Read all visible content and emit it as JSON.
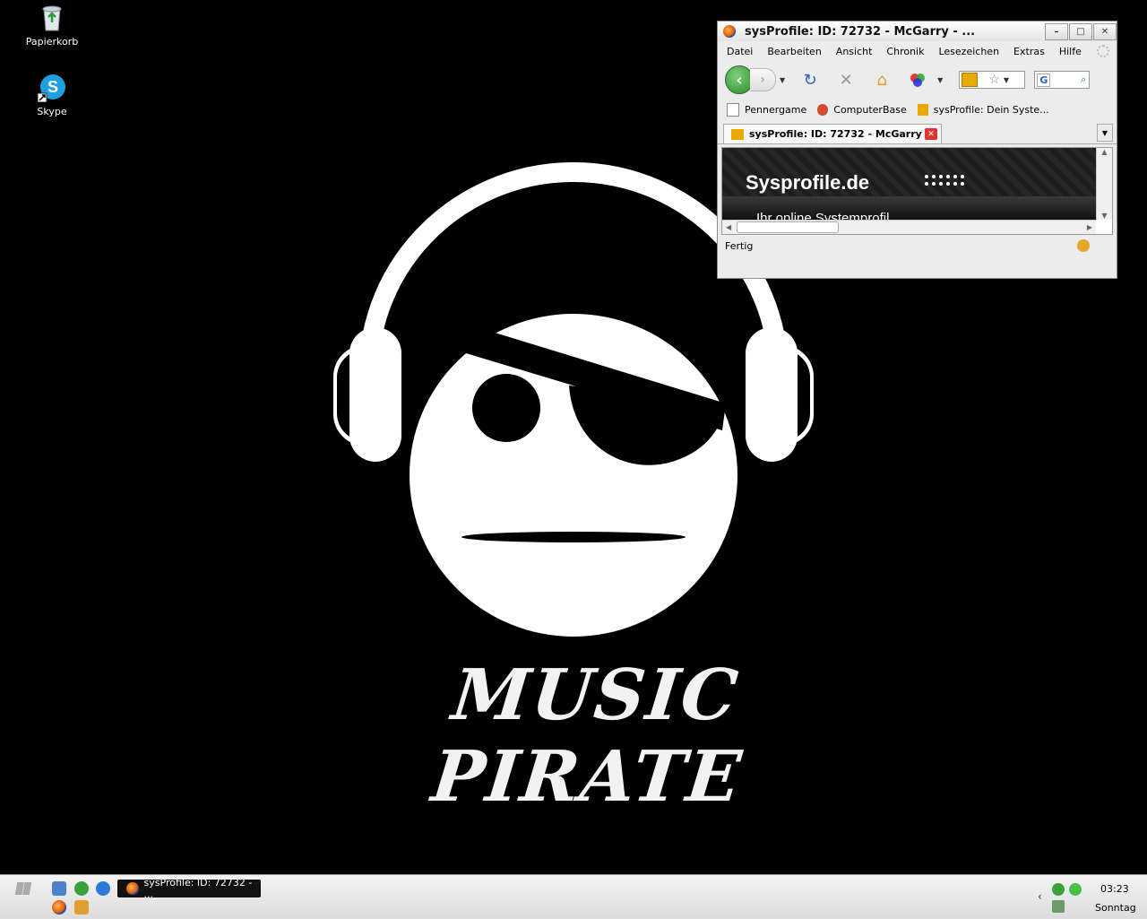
{
  "desktop": {
    "icons": [
      {
        "label": "Papierkorb",
        "icon": "recycle-bin-icon"
      },
      {
        "label": "Skype",
        "icon": "skype-icon"
      }
    ],
    "wallpaper_text": "MUSIC PIRATE"
  },
  "browser": {
    "title": "sysProfile: ID: 72732 - McGarry - ...",
    "window_buttons": {
      "minimize": "–",
      "maximize": "□",
      "close": "✕"
    },
    "menu": [
      "Datei",
      "Bearbeiten",
      "Ansicht",
      "Chronik",
      "Lesezeichen",
      "Extras",
      "Hilfe"
    ],
    "bookmarks": [
      {
        "label": "Pennergame",
        "icon": "page-icon"
      },
      {
        "label": "ComputerBase",
        "icon": "computerbase-icon"
      },
      {
        "label": "sysProfile: Dein Syste...",
        "icon": "sysprofile-icon"
      }
    ],
    "tab": {
      "title": "sysProfile: ID: 72732 - McGarry"
    },
    "page": {
      "logo": "Sysprofile.de",
      "subtitle": "Ihr online Systemprofil"
    },
    "status": "Fertig"
  },
  "taskbar": {
    "task_button": "sysProfile: ID: 72732 - ...",
    "clock_time": "03:23",
    "clock_day": "Sonntag"
  },
  "colors": {
    "accent_green": "#2c8a2c",
    "taskbar_bg": "#e6e6e6",
    "desktop_bg": "#000000"
  }
}
